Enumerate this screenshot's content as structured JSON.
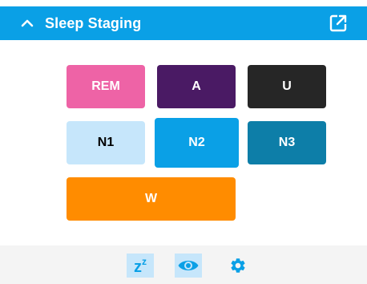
{
  "header": {
    "title": "Sleep Staging",
    "background": "#0aa0e6",
    "collapse_icon": "chevron-up-icon",
    "popout_icon": "open-in-new-icon"
  },
  "stages": [
    {
      "label": "REM",
      "bg": "#ee63a6",
      "fg": "#ffffff"
    },
    {
      "label": "A",
      "bg": "#4a1a64",
      "fg": "#ffffff"
    },
    {
      "label": "U",
      "bg": "#262626",
      "fg": "#ffffff"
    },
    {
      "label": "N1",
      "bg": "#c6e6fb",
      "fg": "#000000"
    },
    {
      "label": "N2",
      "bg": "#0aa0e6",
      "fg": "#ffffff",
      "selected": true
    },
    {
      "label": "N3",
      "bg": "#0d7ea8",
      "fg": "#ffffff"
    },
    {
      "label": "W",
      "bg": "#ff8c00",
      "fg": "#ffffff"
    }
  ],
  "toolbar": {
    "sleep_label": "z",
    "sleep_sup": "z",
    "sleep_icon": "sleep-zz-icon",
    "view_icon": "eye-icon",
    "settings_icon": "gear-icon",
    "accent": "#0aa0e6",
    "active_bg": "#c6e6fb"
  }
}
